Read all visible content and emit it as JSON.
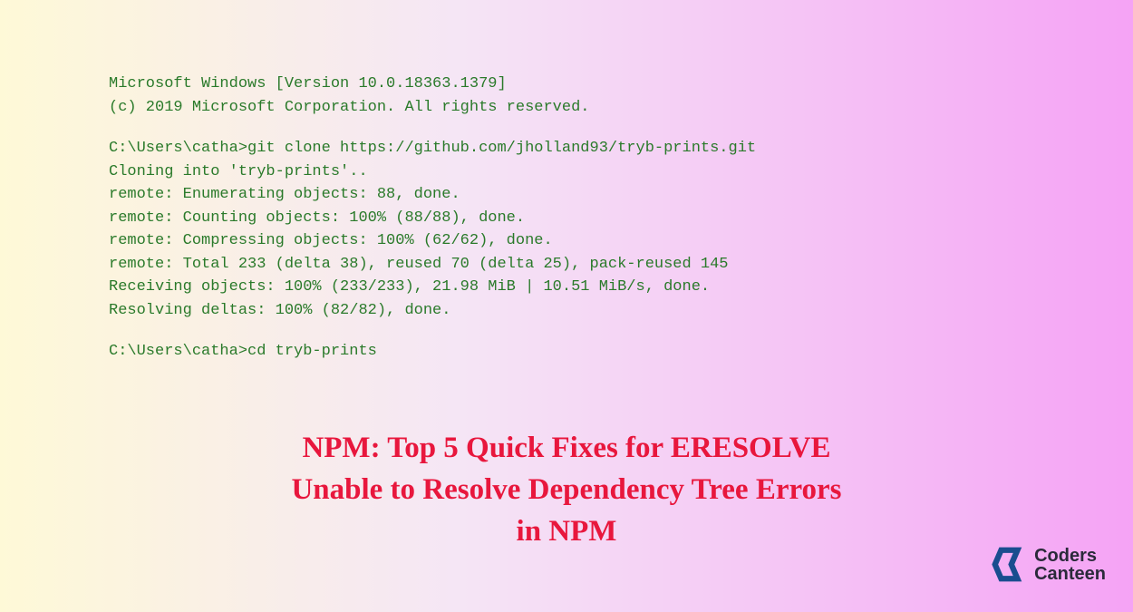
{
  "terminal": {
    "header_line1": "Microsoft Windows [Version 10.0.18363.1379]",
    "header_line2": "(c) 2019 Microsoft Corporation. All rights reserved.",
    "prompt1": "C:\\Users\\catha>git clone https://github.com/jholland93/tryb-prints.git",
    "line1": "Cloning into 'tryb-prints'..",
    "line2": "remote: Enumerating objects: 88, done.",
    "line3": "remote: Counting objects: 100% (88/88), done.",
    "line4": "remote: Compressing objects: 100% (62/62), done.",
    "line5": "remote: Total 233 (delta 38), reused 70 (delta 25), pack-reused 145",
    "line6": "Receiving objects: 100% (233/233), 21.98 MiB | 10.51 MiB/s, done.",
    "line7": "Resolving deltas: 100% (82/82), done.",
    "prompt2": "C:\\Users\\catha>cd tryb-prints"
  },
  "title": {
    "line1": "NPM: Top 5 Quick Fixes for ERESOLVE",
    "line2": "Unable to Resolve Dependency Tree Errors",
    "line3": "in NPM"
  },
  "logo": {
    "text1": "Coders",
    "text2": "Canteen"
  }
}
